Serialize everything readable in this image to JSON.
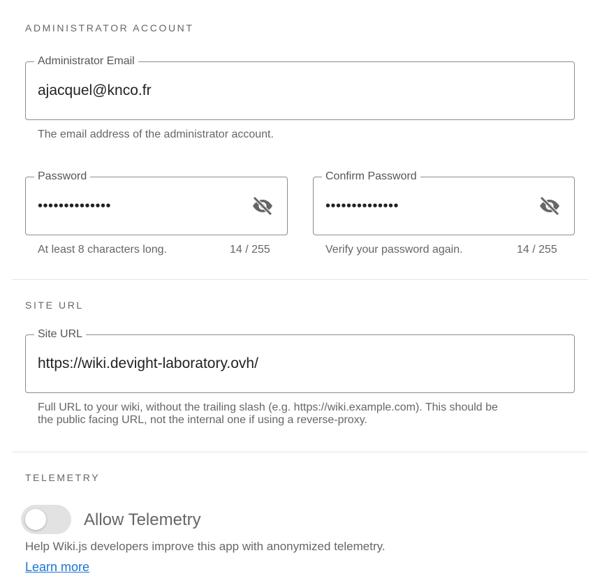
{
  "admin_section": {
    "title": "ADMINISTRATOR ACCOUNT",
    "email": {
      "label": "Administrator Email",
      "value": "ajacquel@knco.fr",
      "hint": "The email address of the administrator account."
    },
    "password": {
      "label": "Password",
      "value": "••••••••••••••",
      "hint": "At least 8 characters long.",
      "counter": "14 / 255",
      "icon": "eye-off-icon"
    },
    "confirm_password": {
      "label": "Confirm Password",
      "value": "••••••••••••••",
      "hint": "Verify your password again.",
      "counter": "14 / 255",
      "icon": "eye-off-icon"
    }
  },
  "site_url_section": {
    "title": "SITE URL",
    "site_url": {
      "label": "Site URL",
      "value": "https://wiki.devight-laboratory.ovh/",
      "hint_line1": "Full URL to your wiki, without the trailing slash (e.g. https://wiki.example.com). This should be",
      "hint_line2": "the public facing URL, not the internal one if using a reverse-proxy."
    }
  },
  "telemetry_section": {
    "title": "TELEMETRY",
    "toggle_label": "Allow Telemetry",
    "toggle_on": false,
    "description": "Help Wiki.js developers improve this app with anonymized telemetry.",
    "learn_more": "Learn more"
  },
  "colors": {
    "accent_link": "#1976d2",
    "border": "#8c8c8c",
    "muted_text": "#666666"
  }
}
